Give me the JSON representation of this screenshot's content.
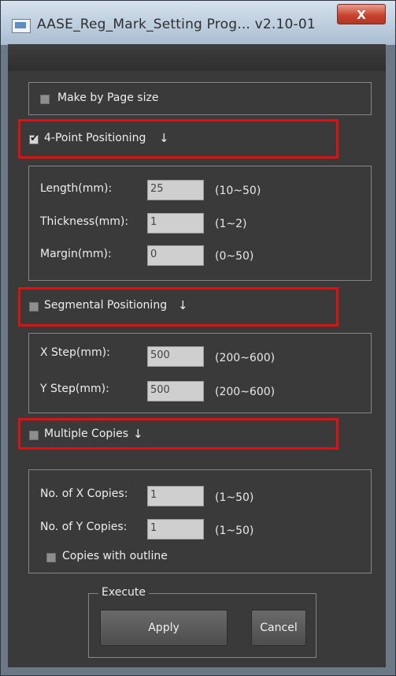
{
  "window": {
    "title": "AASE_Reg_Mark_Setting Prog... v2.10-01",
    "close_symbol": "X"
  },
  "options": {
    "make_by_page_size": {
      "label": "Make by Page size",
      "checked": false
    },
    "four_point": {
      "label": "4-Point Positioning",
      "arrow": "↓",
      "checked": true
    },
    "segmental": {
      "label": "Segmental Positioning",
      "arrow": "↓",
      "checked": false
    },
    "multiple_copies": {
      "label": "Multiple Copies",
      "arrow": "↓",
      "checked": false
    }
  },
  "four_point_fields": [
    {
      "label": "Length(mm):",
      "value": "25",
      "range": "(10~50)"
    },
    {
      "label": "Thickness(mm):",
      "value": "1",
      "range": "(1~2)"
    },
    {
      "label": "Margin(mm):",
      "value": "0",
      "range": "(0~50)"
    }
  ],
  "segmental_fields": [
    {
      "label": "X Step(mm):",
      "value": "500",
      "range": "(200~600)"
    },
    {
      "label": "Y Step(mm):",
      "value": "500",
      "range": "(200~600)"
    }
  ],
  "copies_fields": [
    {
      "label": "No. of X Copies:",
      "value": "1",
      "range": "(1~50)"
    },
    {
      "label": "No. of Y Copies:",
      "value": "1",
      "range": "(1~50)"
    }
  ],
  "copies_with_outline": {
    "label": "Copies with outline",
    "checked": false
  },
  "execute": {
    "group_label": "Execute",
    "apply_label": "Apply",
    "cancel_label": "Cancel"
  },
  "colors": {
    "highlight": "#e01010",
    "client_bg": "#3a3a3a"
  }
}
